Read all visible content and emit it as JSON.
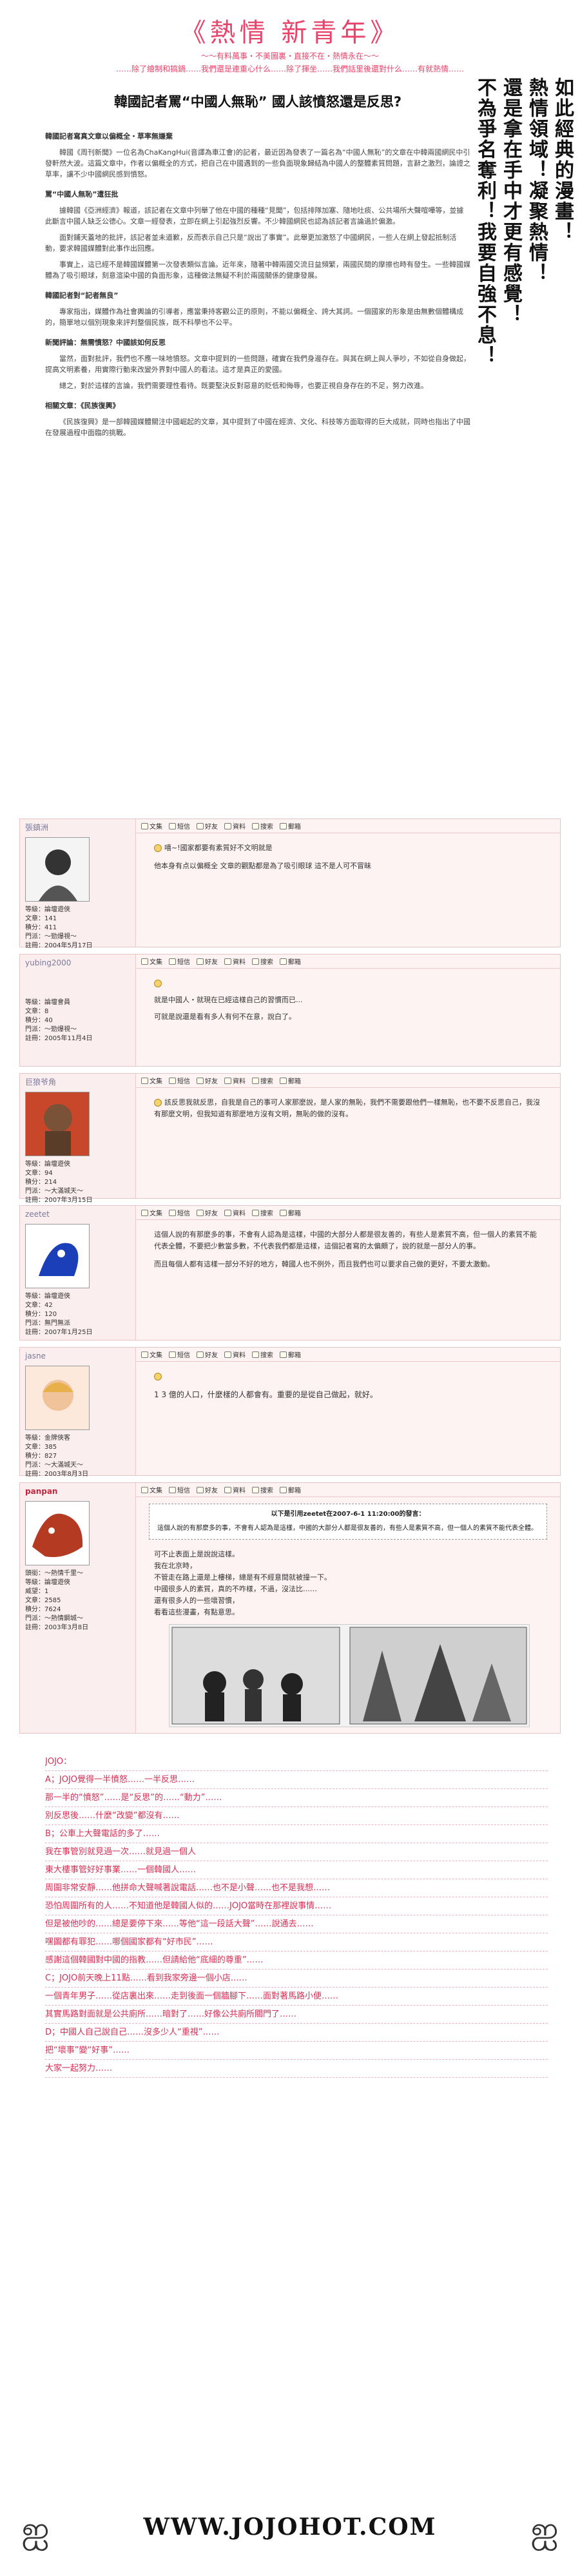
{
  "banner": {
    "title": "《熱情 新青年》",
    "line1": "～～有料萬事・不美圖裏・直接不在・熱情永在～～",
    "line2": "……除了繪制和搞鍋……我們還是連重心什么……除了揮坐……我們話里後還對什么……有就熱情……"
  },
  "article": {
    "headline": "韓國記者罵“中國人無恥” 國人該憤怒還是反思?",
    "p1": "韓國記者寫真文章以偏概全・草率無嫌棄",
    "p2": "韓國《周刊新聞》一位名為ChaKangHui(音譯為車江會)的記者，最近因為發表了一篇名為“中國人無恥”的文章在中韓兩國網民中引發軒然大波。這篇文章中，作者以偏概全的方式，把自己在中國遇到的一些負面現象歸結為中國人的整體素質問題，言辭之激烈，論證之草率，讓不少中國網民感到憤怒。",
    "sub1": "罵“中國人無恥”遭狂批",
    "p3": "據韓國《亞洲經濟》報道，該記者在文章中列舉了他在中國的種種“見聞”，包括排隊加塞、隨地吐痰、公共場所大聲喧嘩等，並據此斷言中國人缺乏公德心。文章一經發表，立即在網上引起強烈反響。不少韓國網民也認為該記者言論過於偏激。",
    "p4": "面對鋪天蓋地的批評，該記者並未道歉，反而表示自己只是“說出了事實”。此舉更加激怒了中國網民，一些人在網上發起抵制活動，要求韓國媒體對此事作出回應。",
    "p5": "事實上，這已經不是韓國媒體第一次發表類似言論。近年來，隨著中韓兩國交流日益頻繁，兩國民間的摩擦也時有發生。一些韓國媒體為了吸引眼球，刻意渲染中國的負面形象，這種做法無疑不利於兩國關係的健康發展。",
    "sub2": "韓國記者對“記者無良”",
    "p6": "專家指出，媒體作為社會輿論的引導者，應當秉持客觀公正的原則，不能以偏概全、誇大其詞。一個國家的形象是由無數個體構成的，簡單地以個別現象來評判整個民族，既不科學也不公平。",
    "sub3": "新聞評論：無需憤怒？中國該如何反思",
    "p7": "當然，面對批評，我們也不應一味地憤怒。文章中提到的一些問題，確實在我們身邊存在。與其在網上與人爭吵，不如從自身做起，提高文明素養，用實際行動來改變外界對中國人的看法。這才是真正的愛國。",
    "p8": "總之，對於這樣的言論，我們需要理性看待。既要堅決反對惡意的貶低和侮辱，也要正視自身存在的不足，努力改進。",
    "p9": "相關文章：《民族復興》",
    "p10": "《民族復興》是一部韓國媒體關注中國崛起的文章，其中提到了中國在經濟、文化、科技等方面取得的巨大成就，同時也指出了中國在發展過程中面臨的挑戰。"
  },
  "side_text": [
    "如此經典的漫畫！",
    "熱情領域！凝聚熱情！",
    "還是拿在手中才更有感覺！",
    "不為爭名奪利！我要自強不息！"
  ],
  "toolbar": {
    "quote": "文集",
    "mail": "短信",
    "edit": "好友",
    "reply": "資料",
    "search": "搜索",
    "msg": "郵箱"
  },
  "posts": [
    {
      "author": "張鎮洲",
      "meta": [
        "等級：論壇遊俠",
        "文章：141",
        "積分：411",
        "門派：～勁爆視～",
        "註冊：2004年5月17日"
      ],
      "lines": [
        "嘻~!國家都要有素質好不文明就是",
        "他本身有点以偏概全 文章的觀點都是為了吸引眼球 這不是人可不冒昧"
      ]
    },
    {
      "author": "yubing2000",
      "meta": [
        "等級：論壇會員",
        "文章：8",
        "積分：40",
        "門派：～勁爆視～",
        "註冊：2005年11月4日"
      ],
      "lines": [
        "就是中國人・就現在已經這樣自己的習慣而已...",
        "可就是說還是看有多人有何不在意，說白了。"
      ]
    },
    {
      "author": "巨狼爷角",
      "meta": [
        "等級：論壇遊俠",
        "文章：94",
        "積分：214",
        "門派：～大滿城天～",
        "註冊：2007年3月15日"
      ],
      "lines": [
        "該反思我就反思，自我是自己的事可人家那麼說，是人家的無恥，我們不需要跟他們一樣無恥，也不要不反思自己，我沒有那麼文明，但我知道有那麼地方沒有文明，無恥的做的沒有。"
      ]
    },
    {
      "author": "zeetet",
      "meta": [
        "等級：論壇遊俠",
        "文章：42",
        "積分：120",
        "門派：無門無派",
        "註冊：2007年1月25日"
      ],
      "lines": [
        "這個人說的有那麼多的事，不會有人認為是這樣，中國的大部分人都是很友善的，有些人是素質不高，但一個人的素質不能代表全體，不要把少數當多數，不代表我們都是這樣，這個記者寫的太偏頗了，說的就是一部分人的事。",
        "而且每個人都有這樣一部分不好的地方，韓國人也不例外，而且我們也可以要求自己做的更好，不要太激動。"
      ]
    },
    {
      "author": "jasne",
      "meta": [
        "等級：金牌俠客",
        "文章：385",
        "積分：827",
        "門派：～大滿城天～",
        "註冊：2003年8月3日"
      ],
      "lines": [
        "1 3 億的人口，什麼樣的人都會有。重要的是從自己做起，就好。"
      ]
    },
    {
      "author": "panpan",
      "meta": [
        "頭銜：～熱情千里～",
        "等級：論壇遊俠",
        "威望：1",
        "文章：2585",
        "積分：7624",
        "門派：～熱情鋼城～",
        "註冊：2003年3月8日"
      ],
      "quote_head": "以下是引用zeetet在2007-6-1 11:20:00的發言：",
      "quote": "這個人說的有那麼多的事，不會有人認為是這樣，中國的大部分人都是很友善的，有些人是素質不高，但一個人的素質不能代表全體。",
      "lines": [
        "可不止表面上是說說這樣。",
        "我在北京時，",
        "不管走在路上還是上樓梯，總是有不經意間就被撞一下。",
        "中國很多人的素質，真的不咋樣，不過，沒法比……",
        "還有很多人的一些壞習慣，",
        "看看這些漫畫，有點意思。"
      ]
    }
  ],
  "comment": {
    "title": "JOJO：",
    "lines": [
      "A；JOJO覺得一半憤怒……一半反思……",
      "那一半的“憤怒”……是“反思”的……“動力”……",
      "別反思後……什麼“改變”都沒有……",
      "B；公車上大聲電話的多了……",
      "我在事管別就見過一次……就見過一個人",
      "東大樓事管好好事業……一個韓國人……",
      "周圍非常安靜……他拼命大聲喊著說電話……也不是小聲……也不是我想……",
      "恐怕周圍所有的人……不知道他是韓國人似的……JOJO當時在那裡說事情……",
      "但是被他吵的……總是要停下來……等他“這一段話大聲”……說通去……",
      "嘿圖都有罪犯……哪個國家都有“好市民”……",
      "感謝這個韓國對中國的指教……但請給他“底細的尊重”……",
      "C；JOJO前天晚上11點……看到我家旁邊一個小店……",
      "一個青年男子……從店裏出來……走到後面一個牆腳下……面對著馬路小便……",
      "其實馬路對面就是公共廁所……暗對了……好像公共廁所關門了……",
      "D；中國人自己說自己……沒多少人“重視”……",
      "把“壞事”變“好事”……",
      "大家一起努力……"
    ]
  },
  "site_url": "WWW.JOJOHOT.COM"
}
